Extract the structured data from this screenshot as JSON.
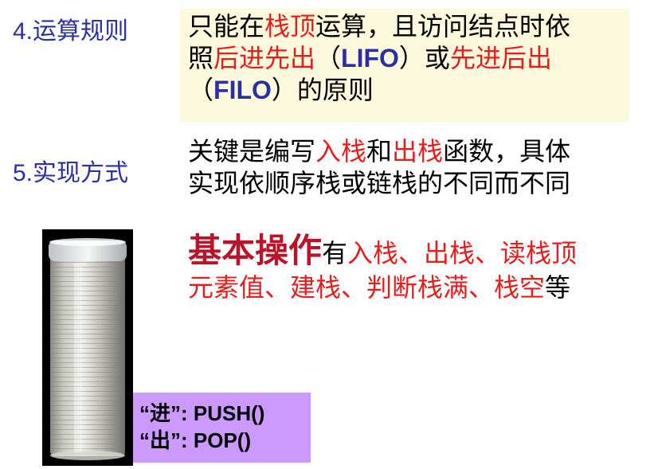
{
  "section4": {
    "number": "4.",
    "label": "运算规则",
    "rule": {
      "t1": "只能在",
      "t2": "栈顶",
      "t3": "运算，且访问结点时依",
      "t4": "照",
      "t5": "后进先出",
      "t6": "（",
      "t7": "LIFO",
      "t8": "）或",
      "t9": "先进后出",
      "t10": "（",
      "t11": "FILO",
      "t12": "）的原则"
    }
  },
  "section5": {
    "number": "5.",
    "label": "实现方式",
    "desc": {
      "t1": "关键是编写",
      "t2": "入栈",
      "t3": "和",
      "t4": "出栈",
      "t5": "函数，具体",
      "t6": "实现依顺序栈或链栈的不同而不同"
    }
  },
  "basic_ops": {
    "title": "基本操作",
    "t1": "有",
    "t2": "入栈、出栈、读栈顶",
    "t3": "元素值、建栈、判断栈满、栈空",
    "t4": "等"
  },
  "push_pop": {
    "push": "“进”: PUSH()",
    "pop": "“出”: POP()"
  },
  "colors": {
    "label_blue": "#2b2fa0",
    "highlight_red": "#e41d1d",
    "title_dark_red": "#b8142a",
    "rule_bg": "#fdf9dd",
    "push_pop_bg": "#cc99ff"
  },
  "image": {
    "subject": "coin-tube-stack"
  }
}
